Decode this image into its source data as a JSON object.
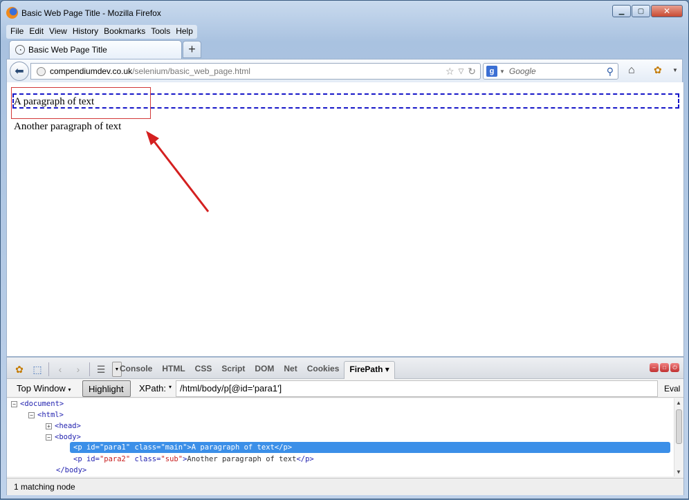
{
  "window": {
    "title": "Basic Web Page Title - Mozilla Firefox"
  },
  "menu": [
    "File",
    "Edit",
    "View",
    "History",
    "Bookmarks",
    "Tools",
    "Help"
  ],
  "tab": {
    "label": "Basic Web Page Title",
    "new_tab": "+"
  },
  "url": {
    "host": "compendiumdev.co.uk",
    "path": "/selenium/basic_web_page.html"
  },
  "search": {
    "placeholder": "Google",
    "engine_icon": "g-icon"
  },
  "page": {
    "para1": "A paragraph of text",
    "para2": "Another paragraph of text"
  },
  "firebug": {
    "tabs": [
      "Console",
      "HTML",
      "CSS",
      "Script",
      "DOM",
      "Net",
      "Cookies"
    ],
    "active_tab": "FirePath",
    "firepath": {
      "top_window": "Top Window",
      "highlight": "Highlight",
      "xpath_label": "XPath:",
      "xpath_value": "/html/body/p[@id='para1']",
      "eval": "Eval"
    },
    "tree": {
      "document": "<document>",
      "html": "<html>",
      "head": "<head>",
      "body": "<body>",
      "p1": {
        "open": "<p ",
        "id_attr": "id=",
        "id_val": "\"para1\"",
        "class_attr": " class=",
        "class_val": "\"main\"",
        "close": ">",
        "text": "A paragraph of text",
        "end": "</p>"
      },
      "p2": {
        "open": "<p ",
        "id_attr": "id=",
        "id_val": "\"para2\"",
        "class_attr": " class=",
        "class_val": "\"sub\"",
        "close": ">",
        "text": "Another paragraph of text",
        "end": "</p>"
      },
      "body_end": "</body>"
    },
    "status": "1 matching node"
  }
}
